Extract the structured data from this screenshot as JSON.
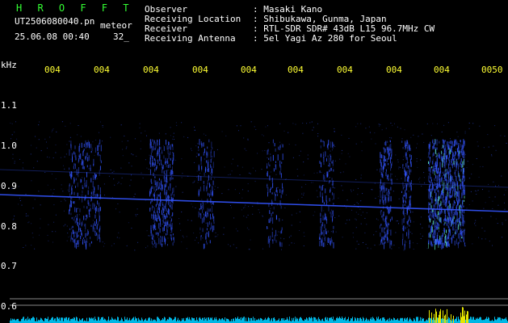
{
  "header": {
    "brand": "H R O F F T",
    "filename": "UT2506080040.pn",
    "mode": "meteor",
    "datetime": "25.06.08 00:40",
    "value": "32_"
  },
  "station": {
    "observer_label": "Observer",
    "observer_value": ": Masaki Kano",
    "location_label": "Receiving Location",
    "location_value": ": Shibukawa, Gunma, Japan",
    "receiver_label": "Receiver",
    "receiver_value": ": RTL-SDR SDR# 43dB L15 96.7MHz CW",
    "antenna_label": "Receiving Antenna",
    "antenna_value": ": 5el Yagi Az 280 for Seoul"
  },
  "axis": {
    "unit": "kHz",
    "y_ticks": [
      "1.1",
      "1.0",
      "0.9",
      "0.8",
      "0.7",
      "0.6"
    ],
    "x_ticks": [
      "004",
      "004",
      "004",
      "004",
      "004",
      "004",
      "004",
      "004",
      "004",
      "0050"
    ]
  },
  "colors": {
    "background": "#000000",
    "brand": "#33ff33",
    "time_label": "#ffff33",
    "signal": "#3355ff",
    "signal_peak": "#66ffcc",
    "baseline": "#00ccff",
    "baseline_peak": "#ffff00"
  }
}
